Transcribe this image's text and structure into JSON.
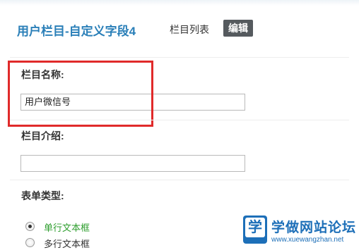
{
  "header": {
    "title": "用户栏目-自定义字段4",
    "tabs": [
      {
        "label": "栏目列表",
        "active": false
      },
      {
        "label": "编辑",
        "active": true
      }
    ]
  },
  "form": {
    "column_name": {
      "label": "栏目名称:",
      "value": "用户微信号"
    },
    "column_intro": {
      "label": "栏目介绍:",
      "value": ""
    },
    "form_type": {
      "label": "表单类型:",
      "options": [
        {
          "label": "单行文本框",
          "selected": true
        },
        {
          "label": "多行文本框",
          "selected": false
        }
      ]
    }
  },
  "watermark": {
    "logo_char": "学",
    "title": "学做网站论坛",
    "url": "www.xuewangzhan.net"
  },
  "colors": {
    "title": "#2a7fb8",
    "active_tab_bg": "#555a5e",
    "highlight": "#e02a2a",
    "selected_option": "#2e9e2e",
    "watermark": "#1d6fb8"
  },
  "icons": {
    "radio_selected": "radio-selected-icon",
    "radio_unselected": "radio-unselected-icon"
  }
}
